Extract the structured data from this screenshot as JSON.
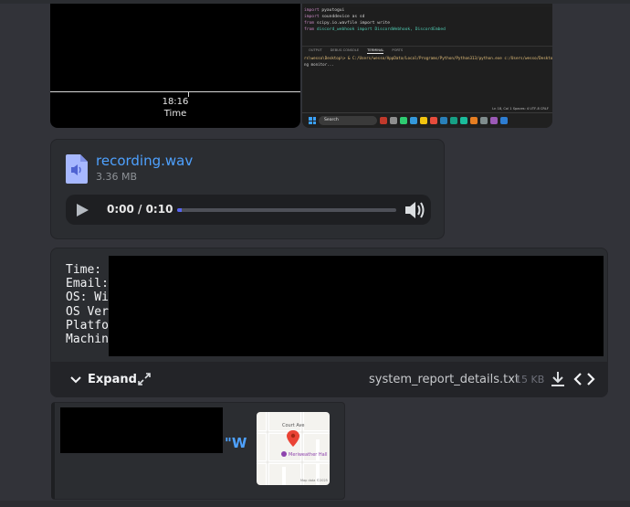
{
  "image_left": {
    "tick_label": "18:16",
    "axis_title": "Time"
  },
  "image_right": {
    "code_lines": [
      {
        "kw": "import",
        "rest": " pyautogui"
      },
      {
        "kw": "import",
        "rest": " sounddevice as sd"
      },
      {
        "kw": "from",
        "rest": " scipy.io.wavfile import write"
      },
      {
        "kw": "from",
        "rest": " discord_webhook import DiscordWebhook, DiscordEmbed"
      }
    ],
    "terminal_tabs": [
      "OUTPUT",
      "DEBUG CONSOLE",
      "TERMINAL",
      "PORTS"
    ],
    "terminal_lines": [
      "rs\\wesso\\Desktop\\> & C:/Users/wesso/AppData/Local/Programs/Python/Python313/python.exe c:/Users/wesso/Desktop/",
      "ng monitor..."
    ],
    "status_bar": "Ln 18, Col 1    Spaces: 4    UTF-8    CRLF",
    "taskbar_search": "Search"
  },
  "audio": {
    "file_name": "recording.wav",
    "file_size": "3.36 MB",
    "time_readout": "0:00 / 0:10",
    "progress": 0.02
  },
  "text_file": {
    "preview_lines": [
      "Time:",
      "Email:",
      "OS: Wi",
      "OS Ver",
      "Platfo",
      "Machin"
    ],
    "expand_label": "Expand",
    "file_name": "system_report_details.txt",
    "file_size": "15 KB"
  },
  "embed": {
    "link_fragment": "\"W",
    "map": {
      "street": "Court Ave",
      "place": "Meriweather Hall",
      "attribution": "Map data ©2025"
    }
  },
  "colors": {
    "link": "#4ea1ff",
    "progress_fill": "#5865f2",
    "background": "#323339",
    "card": "#2b2d31"
  }
}
